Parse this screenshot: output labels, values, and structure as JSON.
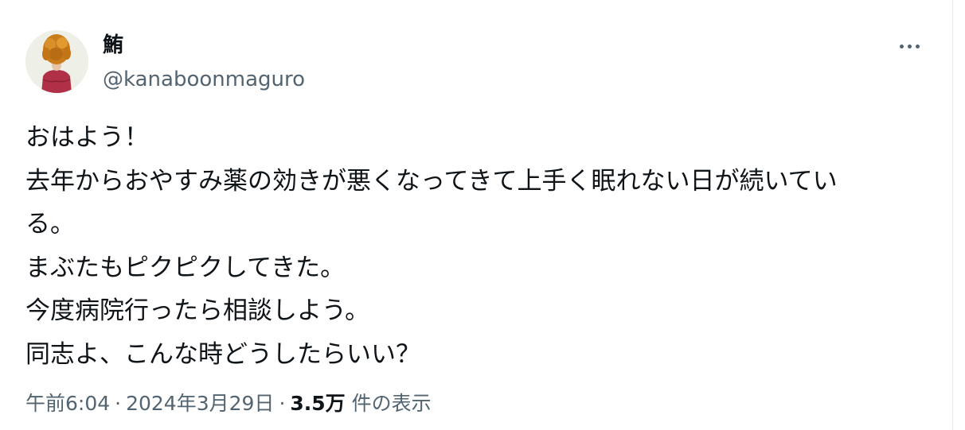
{
  "user": {
    "display_name": "鮪",
    "handle": "@kanaboonmaguro"
  },
  "tweet": {
    "text": "おはよう！\n去年からおやすみ薬の効きが悪くなってきて上手く眠れない日が続いてい\nる。\nまぶたもピクピクしてきた。\n今度病院行ったら相談しよう。\n同志よ、こんな時どうしたらいい？",
    "time": "午前6:04",
    "separator": "·",
    "date": "2024年3月29日",
    "views_count": "3.5万",
    "views_label": "件の表示"
  },
  "icons": {
    "more": "more-horizontal-icon",
    "avatar": "profile-photo"
  },
  "colors": {
    "text_primary": "#0f1419",
    "text_secondary": "#536471",
    "background": "#ffffff"
  }
}
